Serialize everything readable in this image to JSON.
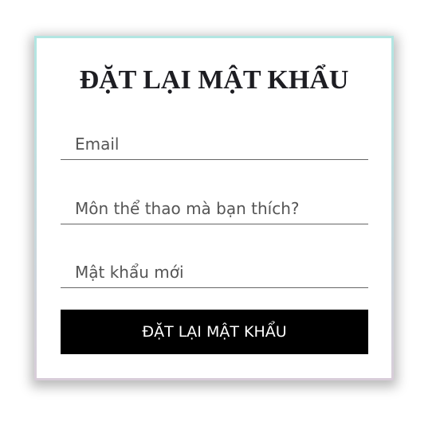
{
  "form": {
    "title": "ĐẶT LẠI MẬT KHẨU",
    "email_placeholder": "Email",
    "question_placeholder": "Môn thể thao mà bạn thích?",
    "password_placeholder": "Mật khẩu mới",
    "submit_label": "ĐẶT LẠI MẬT KHẨU"
  }
}
